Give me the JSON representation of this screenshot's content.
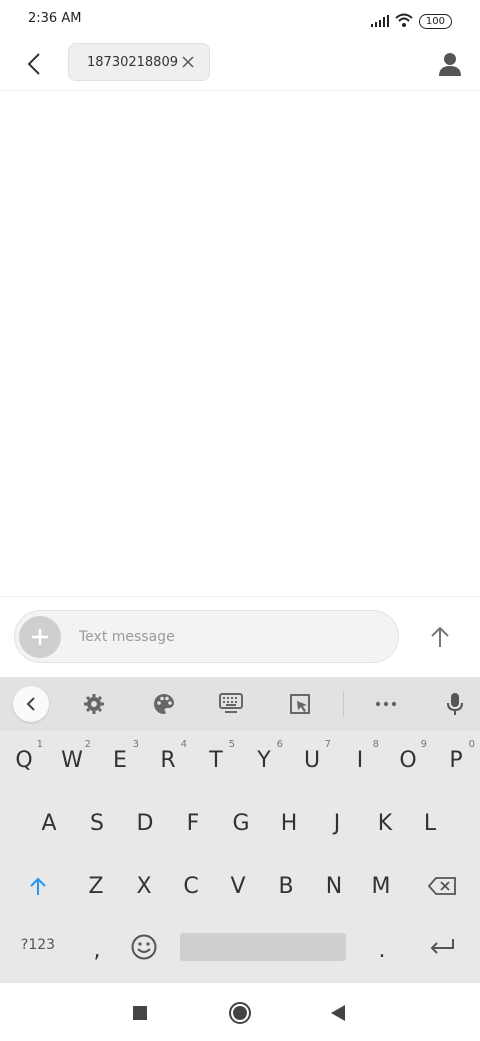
{
  "status_bar": {
    "time": "2:36 AM",
    "battery": "100",
    "signal_icon": "signal-icon",
    "wifi_icon": "wifi-icon"
  },
  "header": {
    "back_icon": "back-arrow-icon",
    "recipient": "18730218809",
    "chip_close_icon": "close-icon",
    "contact_icon": "person-icon"
  },
  "compose": {
    "attach_icon": "plus-icon",
    "placeholder": "Text message",
    "value": "",
    "send_icon": "arrow-up-icon"
  },
  "keyboard": {
    "toolbar": [
      "chevron-left-icon",
      "gear-icon",
      "palette-icon",
      "keyboard-icon",
      "clipboard-icon",
      "more-icon",
      "microphone-icon"
    ],
    "row1": [
      {
        "key": "Q",
        "hint": "1"
      },
      {
        "key": "W",
        "hint": "2"
      },
      {
        "key": "E",
        "hint": "3"
      },
      {
        "key": "R",
        "hint": "4"
      },
      {
        "key": "T",
        "hint": "5"
      },
      {
        "key": "Y",
        "hint": "6"
      },
      {
        "key": "U",
        "hint": "7"
      },
      {
        "key": "I",
        "hint": "8"
      },
      {
        "key": "O",
        "hint": "9"
      },
      {
        "key": "P",
        "hint": "0"
      }
    ],
    "row2": [
      "A",
      "S",
      "D",
      "F",
      "G",
      "H",
      "J",
      "K",
      "L"
    ],
    "row3": [
      "Z",
      "X",
      "C",
      "V",
      "B",
      "N",
      "M"
    ],
    "row4": {
      "symbols": "?123",
      "comma": ",",
      "period": ".",
      "emoji_icon": "emoji-icon",
      "enter_icon": "enter-icon"
    },
    "shift_icon": "shift-icon",
    "backspace_icon": "backspace-icon",
    "shift_color": "#2196F3"
  },
  "nav_bar": [
    "recents-square-icon",
    "home-circle-icon",
    "back-triangle-icon"
  ]
}
